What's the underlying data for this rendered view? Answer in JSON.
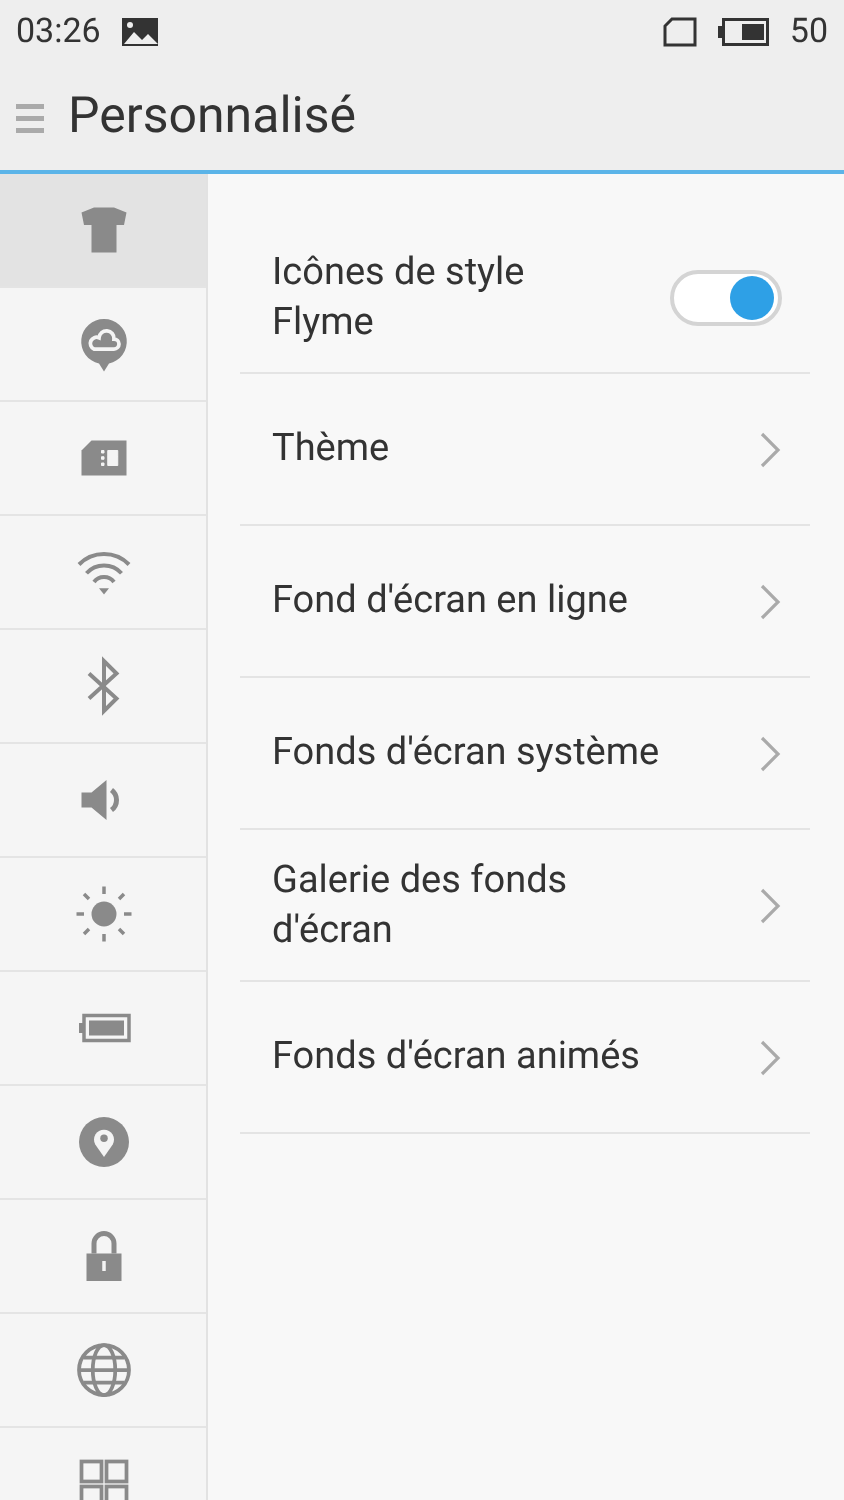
{
  "status_bar": {
    "time": "03:26",
    "battery": "50"
  },
  "header": {
    "title": "Personnalisé"
  },
  "sidebar": {
    "items": [
      {
        "kind": "shirt",
        "selected": true
      },
      {
        "kind": "cloud",
        "selected": false
      },
      {
        "kind": "sim",
        "selected": false
      },
      {
        "kind": "wifi",
        "selected": false
      },
      {
        "kind": "bluetooth",
        "selected": false
      },
      {
        "kind": "sound",
        "selected": false
      },
      {
        "kind": "brightness",
        "selected": false
      },
      {
        "kind": "battery",
        "selected": false
      },
      {
        "kind": "location",
        "selected": false
      },
      {
        "kind": "lock",
        "selected": false
      },
      {
        "kind": "globe",
        "selected": false
      },
      {
        "kind": "apps",
        "selected": false
      }
    ]
  },
  "settings": [
    {
      "kind": "toggle",
      "label": "Icônes de style Flyme",
      "on": true
    },
    {
      "kind": "link",
      "label": "Thème"
    },
    {
      "kind": "link",
      "label": "Fond d'écran en ligne"
    },
    {
      "kind": "link",
      "label": "Fonds d'écran système"
    },
    {
      "kind": "link",
      "label": "Galerie des fonds d'écran"
    },
    {
      "kind": "link",
      "label": "Fonds d'écran animés"
    }
  ]
}
